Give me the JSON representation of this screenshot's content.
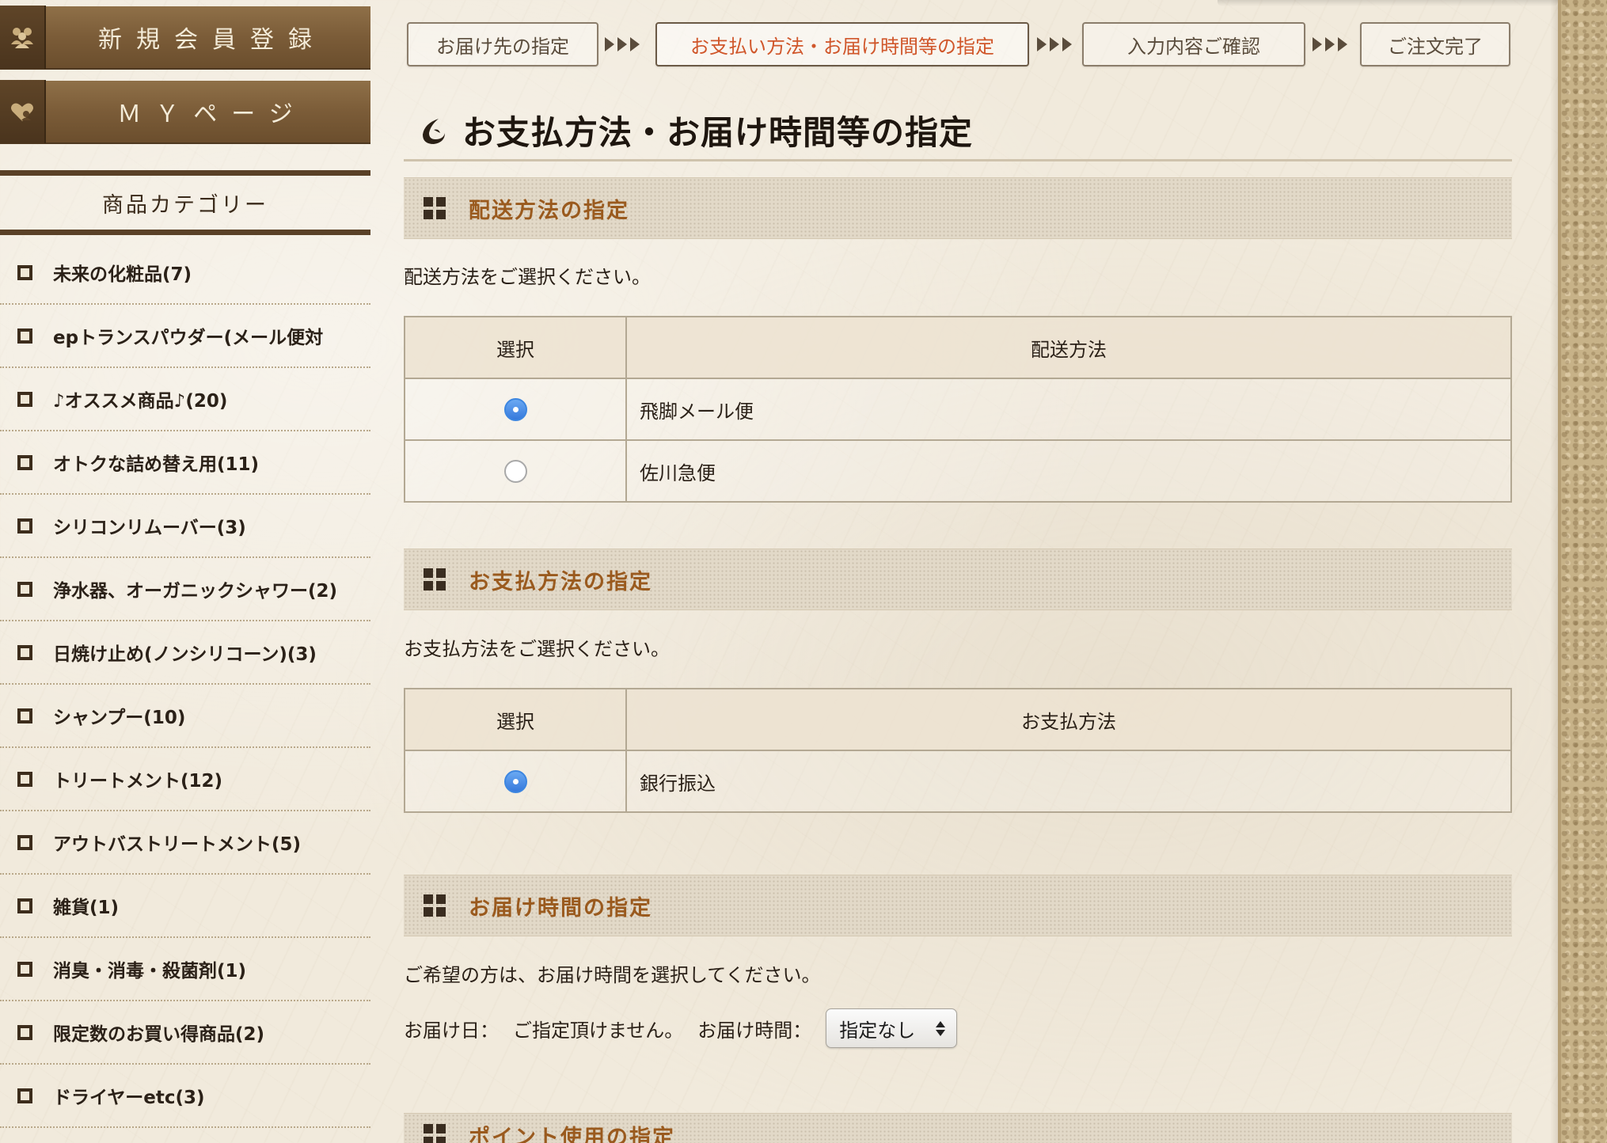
{
  "sidebar": {
    "register_label": "新規会員登録",
    "mypage_label": "ＭＹページ",
    "category_title": "商品カテゴリー",
    "categories": [
      "未来の化粧品(7)",
      "epトランスパウダー(メール便対",
      "♪オススメ商品♪(20)",
      "オトクな詰め替え用(11)",
      "シリコンリムーバー(3)",
      "浄水器、オーガニックシャワー(2)",
      "日焼け止め(ノンシリコーン)(3)",
      "シャンプー(10)",
      "トリートメント(12)",
      "アウトバストリートメント(5)",
      "雑貨(1)",
      "消臭・消毒・殺菌剤(1)",
      "限定数のお買い得商品(2)",
      "ドライヤーetc(3)"
    ]
  },
  "steps": {
    "step1": "お届け先の指定",
    "step2": "お支払い方法・お届け時間等の指定",
    "step3": "入力内容ご確認",
    "step4": "ご注文完了"
  },
  "page_title": "お支払方法・お届け時間等の指定",
  "shipping": {
    "heading": "配送方法の指定",
    "description": "配送方法をご選択ください。",
    "col_select": "選択",
    "col_method": "配送方法",
    "options": [
      {
        "name": "飛脚メール便",
        "selected": true
      },
      {
        "name": "佐川急便",
        "selected": false
      }
    ]
  },
  "payment": {
    "heading": "お支払方法の指定",
    "description": "お支払方法をご選択ください。",
    "col_select": "選択",
    "col_method": "お支払方法",
    "options": [
      {
        "name": "銀行振込",
        "selected": true
      }
    ]
  },
  "delivery_time": {
    "heading": "お届け時間の指定",
    "description": "ご希望の方は、お届け時間を選択してください。",
    "date_label": "お届け日：",
    "date_value": "ご指定頂けません。",
    "time_label": "お届け時間：",
    "time_selected": "指定なし"
  },
  "points": {
    "heading": "ポイント使用の指定"
  },
  "colors": {
    "accent_orange": "#d0562a",
    "heading_brown": "#9a5a1e",
    "sidebar_brown": "#7b5c38",
    "radio_blue": "#3679dc"
  }
}
